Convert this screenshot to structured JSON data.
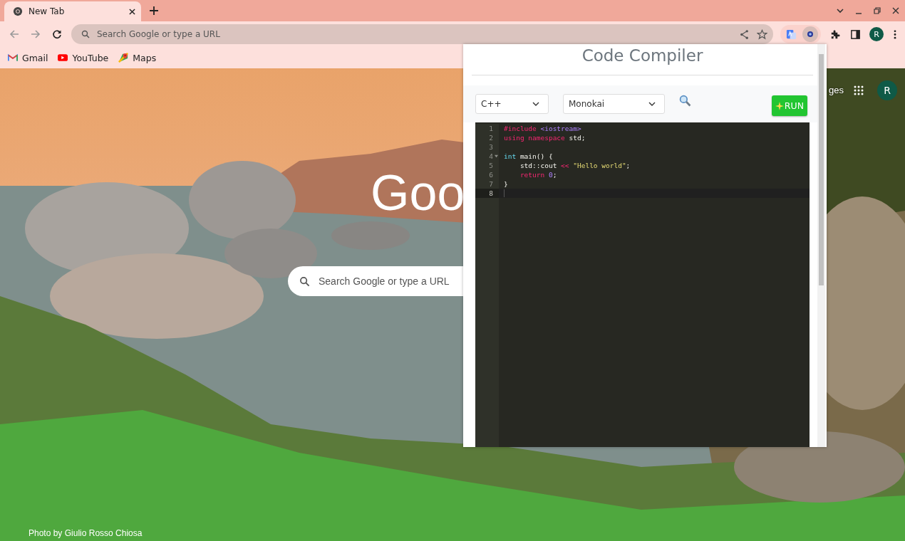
{
  "window": {
    "tabs": [
      {
        "title": "New Tab",
        "selected": true
      }
    ]
  },
  "toolbar": {
    "back": {
      "disabled": true
    },
    "forward": {
      "disabled": true
    },
    "omnibox": {
      "placeholder": "Search Google or type a URL"
    },
    "profile_initial": "R"
  },
  "bookmarks": [
    {
      "label": "Gmail",
      "kind": "gmail"
    },
    {
      "label": "YouTube",
      "kind": "youtube"
    },
    {
      "label": "Maps",
      "kind": "maps"
    }
  ],
  "new_tab_page": {
    "logo": "Goo",
    "search": {
      "placeholder": "Search Google or type a URL"
    },
    "header_link": "ges",
    "profile_initial": "R",
    "photo_credit": "Photo by Giulio Rosso Chiosa"
  },
  "popup": {
    "title": "Code Compiler",
    "language": {
      "value": "C++"
    },
    "theme": {
      "value": "Monokai"
    },
    "run_button": "RUN",
    "editor": {
      "lines": [
        {
          "number": "1",
          "fold": false,
          "active": false,
          "tokens": [
            {
              "kind": "keyword",
              "text": "#include"
            },
            {
              "kind": "constant",
              "text": " <iostream>"
            }
          ]
        },
        {
          "number": "2",
          "fold": false,
          "active": false,
          "tokens": [
            {
              "kind": "keyword",
              "text": "using namespace"
            },
            {
              "kind": "plain",
              "text": " std;"
            }
          ]
        },
        {
          "number": "3",
          "fold": false,
          "active": false
        },
        {
          "number": "4",
          "fold": true,
          "active": false,
          "tokens": [
            {
              "kind": "type",
              "text": "int"
            },
            {
              "kind": "plain",
              "text": " main() {"
            }
          ]
        },
        {
          "number": "5",
          "fold": false,
          "active": false,
          "tokens": [
            {
              "kind": "plain",
              "text": "    std::cout "
            },
            {
              "kind": "keyword",
              "text": "<<"
            },
            {
              "kind": "string",
              "text": " \"Hello world\""
            },
            {
              "kind": "plain",
              "text": ";"
            }
          ]
        },
        {
          "number": "6",
          "fold": false,
          "active": false,
          "tokens": [
            {
              "kind": "keyword",
              "text": "    return"
            },
            {
              "kind": "constant",
              "text": " 0"
            },
            {
              "kind": "plain",
              "text": ";"
            }
          ]
        },
        {
          "number": "7",
          "fold": false,
          "active": false,
          "tokens": [
            {
              "kind": "plain",
              "text": "}"
            }
          ]
        },
        {
          "number": "8",
          "fold": false,
          "active": true
        }
      ]
    }
  }
}
